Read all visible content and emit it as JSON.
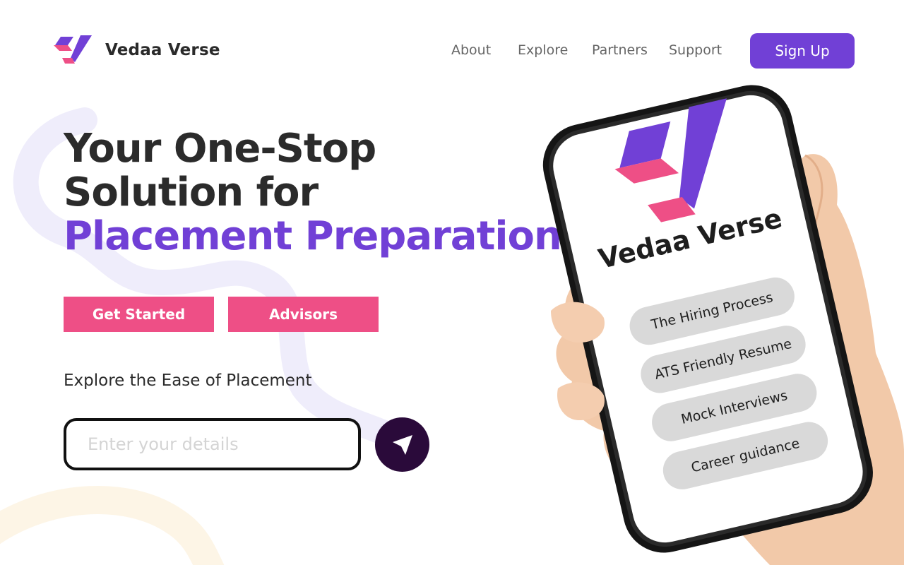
{
  "brand": {
    "name": "Vedaa Verse",
    "logo_icon": "vv-logo-icon"
  },
  "nav": {
    "about": "About",
    "explore": "Explore",
    "partners": "Partners",
    "support": "Support"
  },
  "header": {
    "signup_label": "Sign Up"
  },
  "hero": {
    "title_line1": "Your One-Stop",
    "title_line2": "Solution for",
    "title_line3": "Placement Preparation"
  },
  "actions": {
    "get_started": "Get Started",
    "advisors": "Advisors"
  },
  "explore": {
    "text": "Explore the Ease of Placement"
  },
  "details": {
    "placeholder": "Enter your details",
    "value": ""
  },
  "send_icon": "send-arrow-icon",
  "phone": {
    "brand": "Vedaa Verse",
    "items": [
      "The Hiring Process",
      "ATS Friendly Resume",
      "Mock Interviews",
      "Career guidance"
    ]
  },
  "colors": {
    "primary": "#7140d6",
    "accent_pink": "#ee4f86",
    "send_button": "#2a0a3a",
    "text": "#2b2b2b",
    "nav_text": "#666666"
  }
}
